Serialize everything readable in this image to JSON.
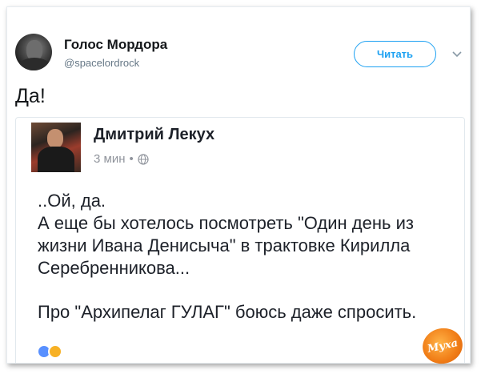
{
  "tweet": {
    "author_name": "Голос Мордора",
    "author_handle": "@spacelordrock",
    "follow_label": "Читать",
    "text": "Да!"
  },
  "quoted_post": {
    "author_name": "Дмитрий Лекух",
    "time": "3 мин",
    "separator": "•",
    "privacy_icon": "globe-icon",
    "lines": [
      "..Ой, да.",
      "А еще бы хотелось посмотреть \"Один день из",
      "жизни Ивана Денисыча\" в трактовке Кирилла",
      "Серебренникова..."
    ],
    "last_line": "Про \"Архипелаг ГУЛАГ\" боюсь даже спросить."
  },
  "watermark": {
    "text": "Муха"
  },
  "colors": {
    "accent": "#1da1f2",
    "text": "#14171a",
    "muted": "#657786",
    "watermark": "#f07c16"
  }
}
